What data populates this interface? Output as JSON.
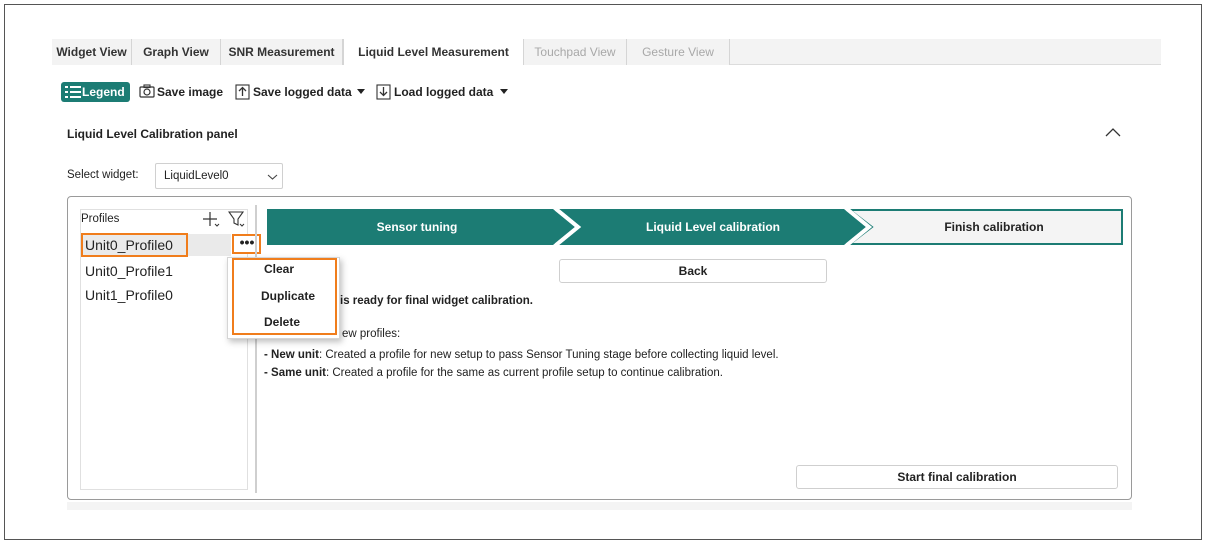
{
  "tabs": [
    {
      "label": "Widget View",
      "state": "normal"
    },
    {
      "label": "Graph View",
      "state": "normal"
    },
    {
      "label": "SNR Measurement",
      "state": "normal"
    },
    {
      "label": "Liquid Level Measurement",
      "state": "active"
    },
    {
      "label": "Touchpad View",
      "state": "disabled"
    },
    {
      "label": "Gesture View",
      "state": "disabled"
    }
  ],
  "toolbar": {
    "legend_label": "Legend",
    "save_image_label": "Save image",
    "save_logged_label": "Save logged data",
    "load_logged_label": "Load logged data"
  },
  "panel": {
    "title": "Liquid Level Calibration panel",
    "select_label": "Select widget:",
    "select_value": "LiquidLevel0"
  },
  "profiles": {
    "title": "Profiles",
    "items": [
      "Unit0_Profile0",
      "Unit0_Profile1",
      "Unit1_Profile0"
    ],
    "selected_index": 0,
    "more_label": "•••"
  },
  "context_menu": {
    "items": [
      "Clear",
      "Duplicate",
      "Delete"
    ]
  },
  "stepper": {
    "steps": [
      {
        "label": "Sensor tuning",
        "state": "done"
      },
      {
        "label": "Liquid Level calibration",
        "state": "done"
      },
      {
        "label": "Finish calibration",
        "state": "current"
      }
    ]
  },
  "main": {
    "back_label": "Back",
    "ready_text": "is ready for final widget calibration.",
    "profiles_text": "ew profiles:",
    "new_unit_bold": "- New unit",
    "new_unit_text": ": Created a profile for new setup to pass Sensor Tuning stage before collecting liquid level.",
    "same_unit_bold": "- Same unit",
    "same_unit_text": ": Created a profile for the same as current profile setup to continue calibration.",
    "start_label": "Start final calibration"
  },
  "colors": {
    "accent": "#1c7c74",
    "highlight": "#f07d1c",
    "step_outline": "#1c7c74",
    "current_step_fill": "#f4f4f4"
  }
}
